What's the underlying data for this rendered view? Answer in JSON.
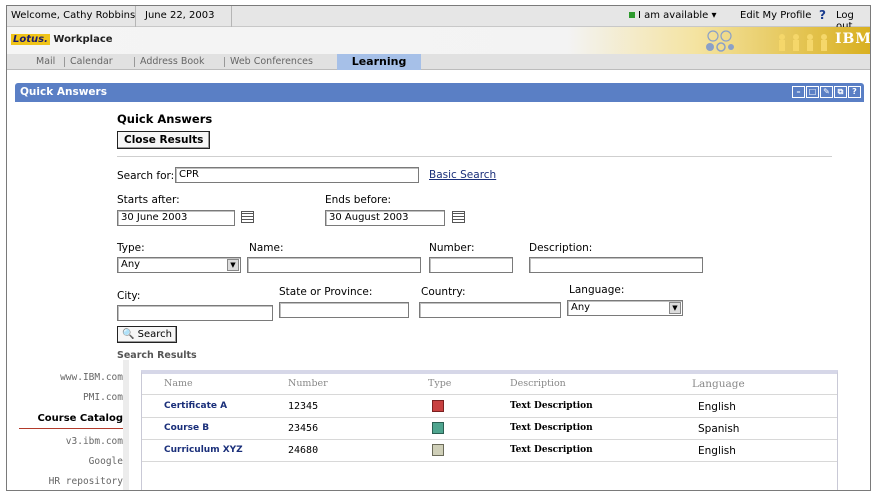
{
  "topbar": {
    "welcome": "Welcome, Cathy Robbins",
    "date": "June 22, 2003",
    "availability": "I am available ▾",
    "edit_profile": "Edit My Profile",
    "help": "?",
    "logout": "Log out"
  },
  "brand": {
    "lotus": "Lotus.",
    "product": "Workplace",
    "ibm": "IBM."
  },
  "nav": {
    "items": [
      "Mail",
      "Calendar",
      "Address Book",
      "Web Conferences"
    ],
    "active": "Learning"
  },
  "portlet": {
    "title": "Quick Answers",
    "buttons": [
      "–",
      "□",
      "✎",
      "⧉",
      "?"
    ]
  },
  "form": {
    "heading": "Quick Answers",
    "close_button": "Close Results",
    "search_for_label": "Search for:",
    "search_for_value": "CPR",
    "basic_search_link": "Basic Search",
    "starts_after_label": "Starts after:",
    "starts_after_value": "30 June 2003",
    "ends_before_label": "Ends before:",
    "ends_before_value": "30 August 2003",
    "type_label": "Type:",
    "type_value": "Any",
    "name_label": "Name:",
    "number_label": "Number:",
    "description_label": "Description:",
    "city_label": "City:",
    "state_label": "State or Province:",
    "country_label": "Country:",
    "language_label": "Language:",
    "language_value": "Any",
    "search_button": "Search",
    "results_label": "Search Results"
  },
  "results": {
    "columns": [
      "Name",
      "Number",
      "Type",
      "Description",
      "Language"
    ],
    "rows": [
      {
        "name": "Certificate A",
        "number": "12345",
        "type_icon": "certificate-icon",
        "description": "Text Description",
        "language": "English"
      },
      {
        "name": "Course B",
        "number": "23456",
        "type_icon": "course-icon",
        "description": "Text Description",
        "language": "Spanish"
      },
      {
        "name": "Curriculum XYZ",
        "number": "24680",
        "type_icon": "curriculum-icon",
        "description": "Text Description",
        "language": "English"
      }
    ]
  },
  "sidebar": {
    "links": [
      "www.IBM.com",
      "PMI.com",
      "Course Catalog",
      "v3.ibm.com",
      "Google",
      "HR repository"
    ],
    "active": "Course Catalog"
  },
  "colors": {
    "portlet_header": "#5a7fc5",
    "nav_active": "#a6c0e8",
    "link": "#1a2f7a",
    "accent_underline": "#b23a2a"
  }
}
